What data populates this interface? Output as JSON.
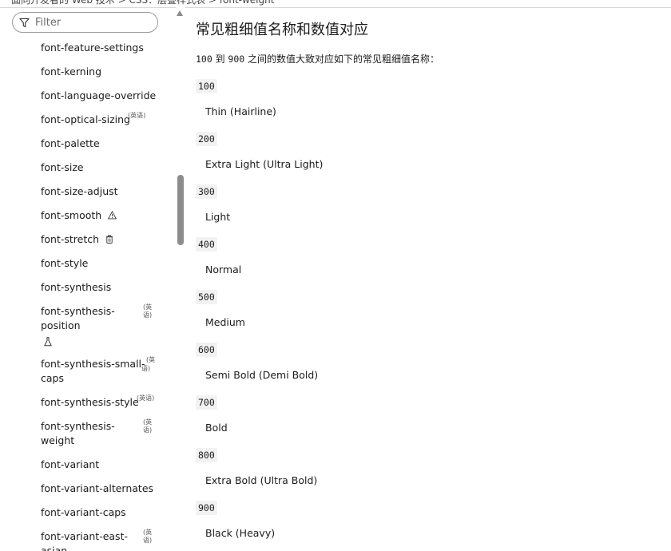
{
  "breadcrumb": "面向开发者的 Web 技术 > CSS：层叠样式表 > font-weight",
  "sidebar": {
    "filter_placeholder": "Filter",
    "items": [
      {
        "label": "font-feature-settings"
      },
      {
        "label": "font-kerning"
      },
      {
        "label": "font-language-override"
      },
      {
        "label": "font-optical-sizing",
        "badge": "(英语)"
      },
      {
        "label": "font-palette"
      },
      {
        "label": "font-size"
      },
      {
        "label": "font-size-adjust"
      },
      {
        "label": "font-smooth",
        "icon": "warning-icon"
      },
      {
        "label": "font-stretch",
        "icon": "trash-icon"
      },
      {
        "label": "font-style"
      },
      {
        "label": "font-synthesis"
      },
      {
        "label_line1": "font-synthesis-",
        "label_line2": "position",
        "badge": "(英语)",
        "icon": "flask-icon"
      },
      {
        "label_line1": "font-synthesis-small-",
        "label_line2": "caps",
        "badge_line1": "(英",
        "badge_line2": "语)"
      },
      {
        "label": "font-synthesis-style",
        "badge": "(英语)"
      },
      {
        "label_line1": "font-synthesis-",
        "label_line2": "weight",
        "badge": "(英语)"
      },
      {
        "label": "font-variant"
      },
      {
        "label": "font-variant-alternates"
      },
      {
        "label": "font-variant-caps"
      },
      {
        "label_line1": "font-variant-east-",
        "label_line2": "asian",
        "badge": "(英语)"
      }
    ]
  },
  "main": {
    "heading": "常见粗细值名称和数值对应",
    "intro_start": "100",
    "intro_mid": " 到 ",
    "intro_end": "900",
    "intro_rest": " 之间的数值大致对应如下的常见粗细值名称：",
    "weights": [
      {
        "value": "100",
        "name": "Thin (Hairline)"
      },
      {
        "value": "200",
        "name": "Extra Light (Ultra Light)"
      },
      {
        "value": "300",
        "name": "Light"
      },
      {
        "value": "400",
        "name": "Normal"
      },
      {
        "value": "500",
        "name": "Medium"
      },
      {
        "value": "600",
        "name": "Semi Bold (Demi Bold)"
      },
      {
        "value": "700",
        "name": "Bold"
      },
      {
        "value": "800",
        "name": "Extra Bold (Ultra Bold)"
      },
      {
        "value": "900",
        "name": "Black (Heavy)"
      }
    ]
  }
}
